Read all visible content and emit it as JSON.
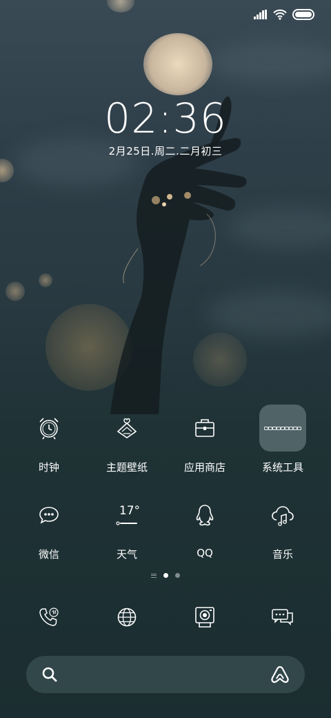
{
  "status_bar": {
    "icons": [
      "signal-icon",
      "wifi-icon",
      "battery-icon"
    ]
  },
  "lock_clock": {
    "time": "02:36",
    "date": "2月25日.周二.二月初三"
  },
  "home": {
    "row1": [
      {
        "label": "时钟",
        "icon": "alarm-clock-icon"
      },
      {
        "label": "主题壁纸",
        "icon": "theme-icon"
      },
      {
        "label": "应用商店",
        "icon": "briefcase-icon"
      },
      {
        "label": "系统工具",
        "icon": "folder-icon"
      }
    ],
    "row2": [
      {
        "label": "微信",
        "icon": "chat-bubble-icon"
      },
      {
        "label": "天气",
        "icon": "weather-icon",
        "temperature": "17°"
      },
      {
        "label": "QQ",
        "icon": "penguin-icon"
      },
      {
        "label": "音乐",
        "icon": "music-cloud-icon"
      }
    ]
  },
  "pager": {
    "pages": 2,
    "active_page": 1
  },
  "dock": [
    "phone-icon",
    "browser-globe-icon",
    "camera-icon",
    "messages-icon"
  ],
  "search": {
    "left_icon": "search-icon",
    "right_icon": "assistant-logo-icon"
  },
  "colors": {
    "background_top": "#3a4a55",
    "background_bottom": "#1b2d30",
    "text": "#ffffff"
  }
}
